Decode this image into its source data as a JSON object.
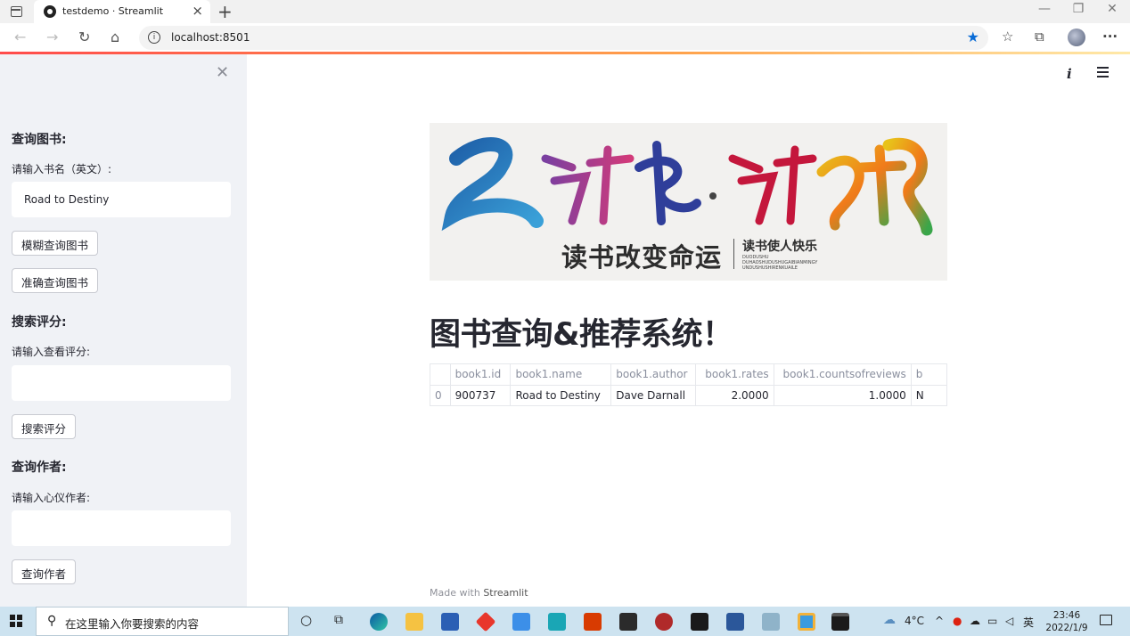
{
  "browser": {
    "tab_title": "testdemo · Streamlit",
    "url": "localhost:8501"
  },
  "sidebar": {
    "sections": [
      {
        "heading": "查询图书:",
        "label": "请输入书名（英文）:",
        "input_value": "Road to Destiny",
        "buttons": [
          "模糊查询图书",
          "准确查询图书"
        ]
      },
      {
        "heading": "搜索评分:",
        "label": "请输入查看评分:",
        "input_value": "",
        "buttons": [
          "搜索评分"
        ]
      },
      {
        "heading": "查询作者:",
        "label": "请输入心仪作者:",
        "input_value": "",
        "buttons": [
          "查询作者"
        ]
      }
    ]
  },
  "main": {
    "banner": {
      "calligraphy": "多读书·读好书",
      "main_text": "读书改变命运",
      "sub_text": "读书使人快乐",
      "tiny_text": "DUODUSHU DUHAOSHUDUSHUGAIBIANMINGY UNDUSHUSHIRENKUAILE"
    },
    "title": "图书查询&推荐系统！",
    "dataframe": {
      "columns": [
        "",
        "book1.id",
        "book1.name",
        "book1.author",
        "book1.rates",
        "book1.countsofreviews",
        "b"
      ],
      "rows": [
        [
          "0",
          "900737",
          "Road to Destiny",
          "Dave Darnall",
          "2.0000",
          "1.0000",
          "N"
        ]
      ]
    },
    "footer": {
      "prefix": "Made with",
      "brand": "Streamlit"
    }
  },
  "taskbar": {
    "search_placeholder": "在这里输入你要搜索的内容",
    "weather": "4°C",
    "ime": "英",
    "time": "23:46",
    "date": "2022/1/9"
  },
  "colors": {
    "sidebar_bg": "#f0f2f6",
    "text": "#262730",
    "accent": "#ff4b4b",
    "star": "#0a6cd6",
    "taskbar_bg": "#cde3f0"
  }
}
